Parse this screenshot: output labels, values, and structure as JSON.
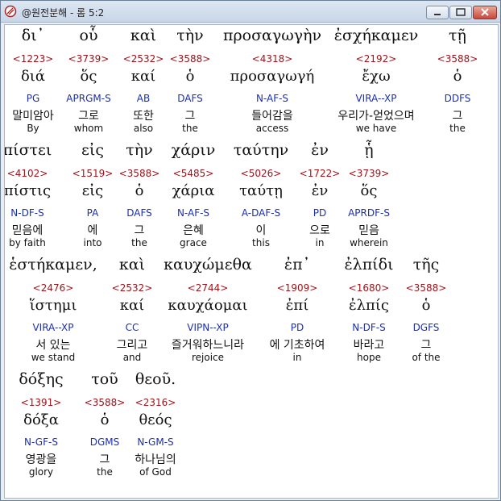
{
  "window": {
    "title": "@원전분해 - 롬 5:2",
    "icon": "app-icon",
    "controls": [
      "minimize-icon",
      "maximize-icon",
      "close-icon"
    ]
  },
  "words": [
    {
      "greek": "δι᾽",
      "num": "<1223>",
      "lex": "διά",
      "parse": "PG",
      "kor": "말미암아",
      "eng": "By"
    },
    {
      "greek": "οὗ",
      "num": "<3739>",
      "lex": "ὅς",
      "parse": "APRGM-S",
      "kor": "그로",
      "eng": "whom"
    },
    {
      "greek": "καὶ",
      "num": "<2532>",
      "lex": "καί",
      "parse": "AB",
      "kor": "또한",
      "eng": "also"
    },
    {
      "greek": "τὴν",
      "num": "<3588>",
      "lex": "ὁ",
      "parse": "DAFS",
      "kor": "그",
      "eng": "the"
    },
    {
      "greek": "προσαγωγὴν",
      "num": "<4318>",
      "lex": "προσαγωγή",
      "parse": "N-AF-S",
      "kor": "들어감을",
      "eng": "access"
    },
    {
      "greek": "ἐσχήκαμεν",
      "num": "<2192>",
      "lex": "ἔχω",
      "parse": "VIRA--XP",
      "kor": "우리가-얻었으며",
      "eng": "we have"
    },
    {
      "greek": "τῇ",
      "num": "<3588>",
      "lex": "ὁ",
      "parse": "DDFS",
      "kor": "그",
      "eng": "the"
    },
    {
      "greek": "πίστει",
      "num": "<4102>",
      "lex": "πίστις",
      "parse": "N-DF-S",
      "kor": "믿음에",
      "eng": "by faith"
    },
    {
      "greek": "εἰς",
      "num": "<1519>",
      "lex": "εἰς",
      "parse": "PA",
      "kor": "에",
      "eng": "into"
    },
    {
      "greek": "τὴν",
      "num": "<3588>",
      "lex": "ὁ",
      "parse": "DAFS",
      "kor": "그",
      "eng": "the"
    },
    {
      "greek": "χάριν",
      "num": "<5485>",
      "lex": "χάρια",
      "parse": "N-AF-S",
      "kor": "은혜",
      "eng": "grace"
    },
    {
      "greek": "ταύτην",
      "num": "<5026>",
      "lex": "ταύτῃ",
      "parse": "A-DAF-S",
      "kor": "이",
      "eng": "this"
    },
    {
      "greek": "ἐν",
      "num": "<1722>",
      "lex": "ἐν",
      "parse": "PD",
      "kor": "으로",
      "eng": "in"
    },
    {
      "greek": "ᾗ",
      "num": "<3739>",
      "lex": "ὅς",
      "parse": "APRDF-S",
      "kor": "믿음",
      "eng": "wherein"
    },
    {
      "greek": "ἑστήκαμεν,",
      "num": "<2476>",
      "lex": "ἵστημι",
      "parse": "VIRA--XP",
      "kor": "서 있는",
      "eng": "we stand"
    },
    {
      "greek": "καὶ",
      "num": "<2532>",
      "lex": "καί",
      "parse": "CC",
      "kor": "그리고",
      "eng": "and"
    },
    {
      "greek": "καυχώμεθα",
      "num": "<2744>",
      "lex": "καυχάομαι",
      "parse": "VIPN--XP",
      "kor": "즐거워하느니라",
      "eng": "rejoice"
    },
    {
      "greek": "ἐπ᾽",
      "num": "<1909>",
      "lex": "ἐπί",
      "parse": "PD",
      "kor": "에 기초하여",
      "eng": "in"
    },
    {
      "greek": "ἐλπίδι",
      "num": "<1680>",
      "lex": "ἐλπίς",
      "parse": "N-DF-S",
      "kor": "바라고",
      "eng": "hope"
    },
    {
      "greek": "τῆς",
      "num": "<3588>",
      "lex": "ὁ",
      "parse": "DGFS",
      "kor": "그",
      "eng": "of the"
    },
    {
      "greek": "δόξης",
      "num": "<1391>",
      "lex": "δόξα",
      "parse": "N-GF-S",
      "kor": "영광을",
      "eng": "glory"
    },
    {
      "greek": "τοῦ",
      "num": "<3588>",
      "lex": "ὁ",
      "parse": "DGMS",
      "kor": "그",
      "eng": "the"
    },
    {
      "greek": "θεοῦ.",
      "num": "<2316>",
      "lex": "θεός",
      "parse": "N-GM-S",
      "kor": "하나님의",
      "eng": "of God"
    }
  ]
}
